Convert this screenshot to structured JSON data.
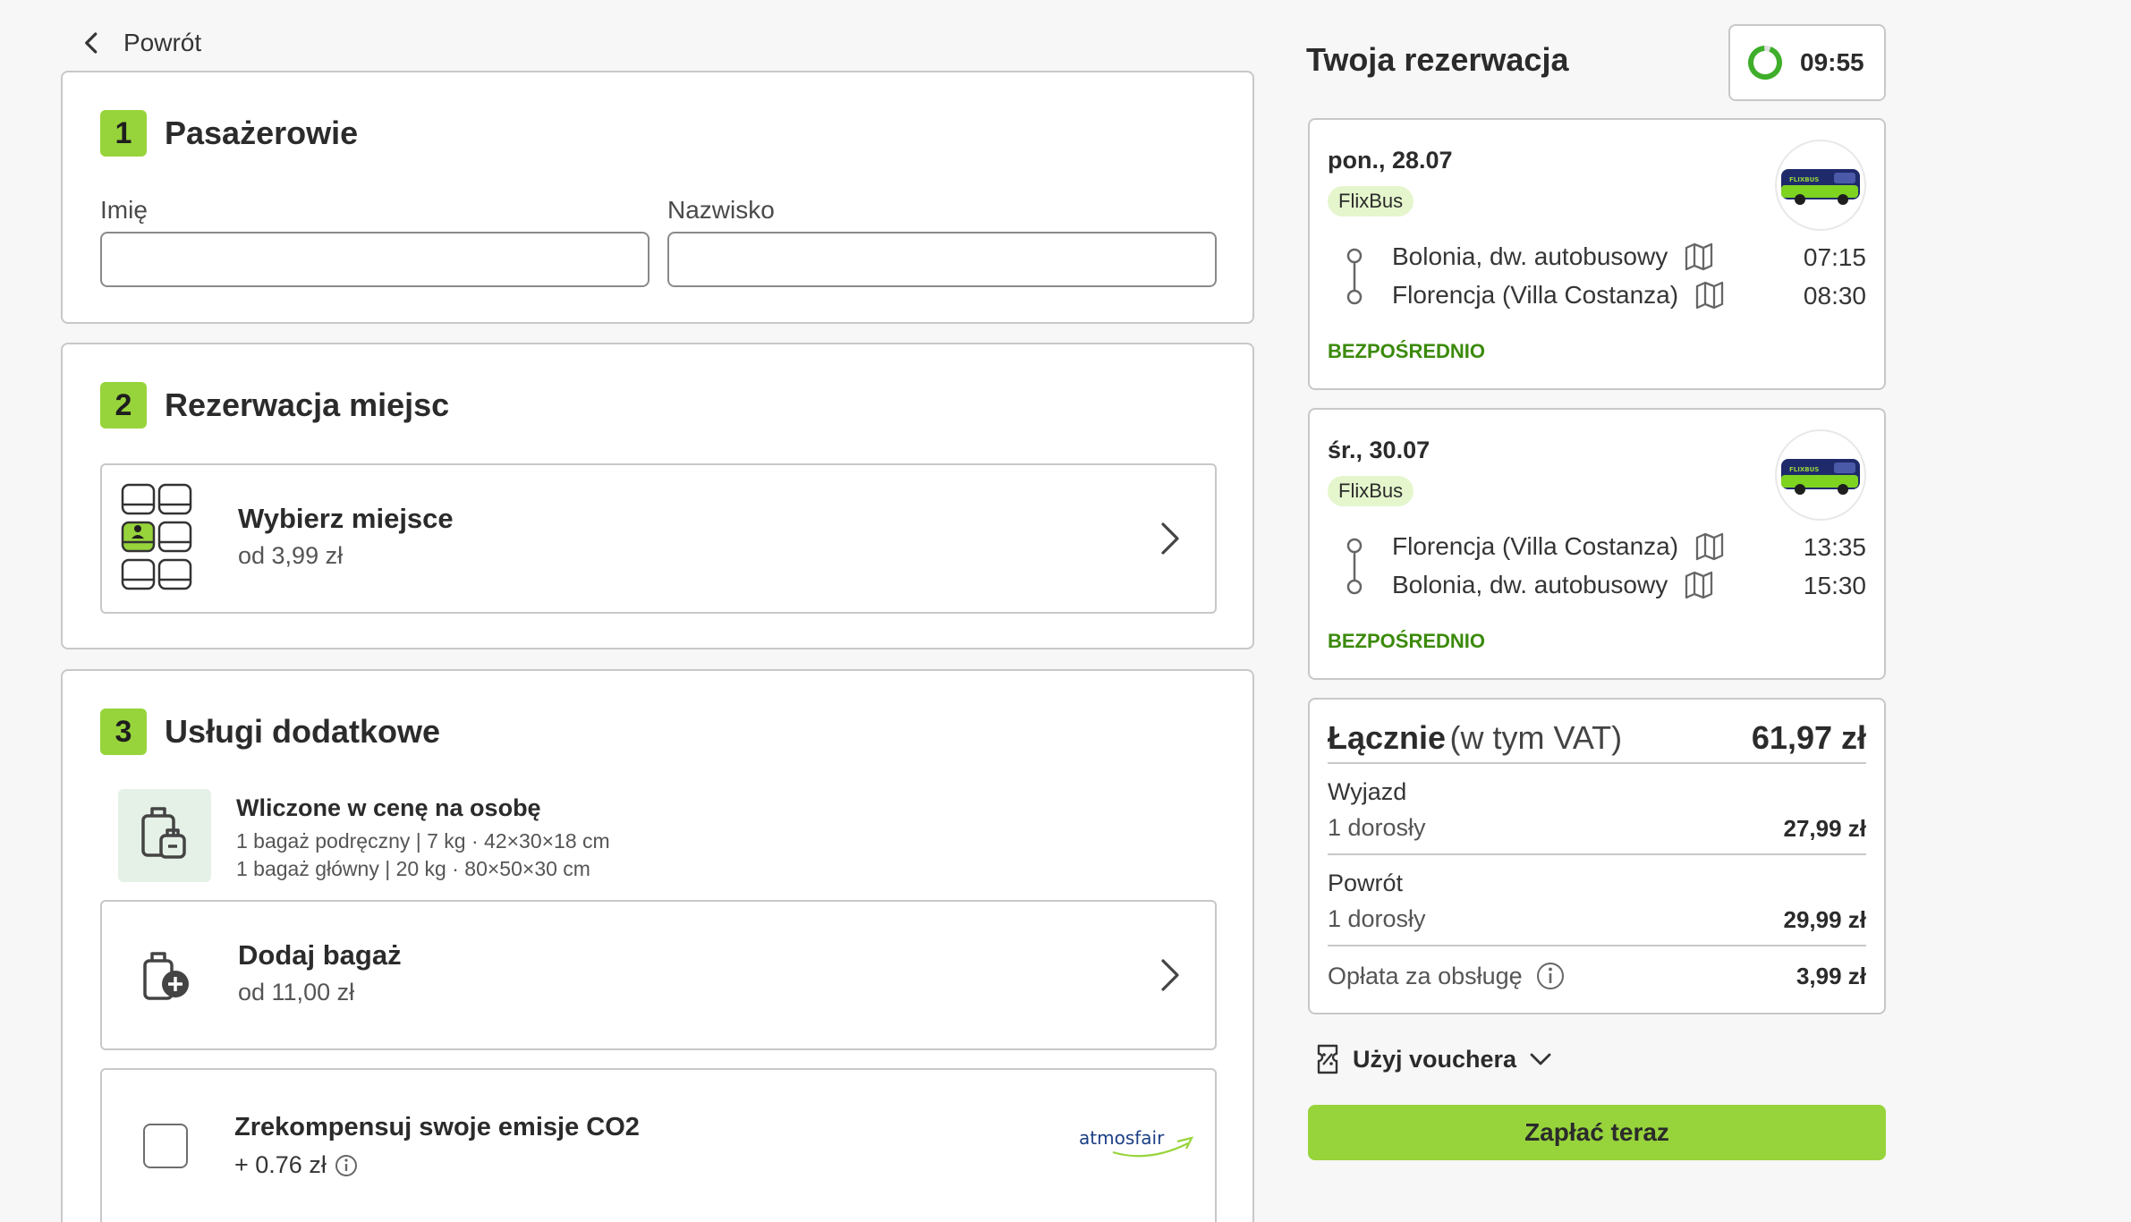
{
  "nav": {
    "back_label": "Powrót"
  },
  "passengers": {
    "step": "1",
    "title": "Pasażerowie",
    "first_name_label": "Imię",
    "first_name_value": "",
    "last_name_label": "Nazwisko",
    "last_name_value": ""
  },
  "seats": {
    "step": "2",
    "title": "Rezerwacja miejsc",
    "option_title": "Wybierz miejsce",
    "option_price": "od 3,99 zł"
  },
  "extras": {
    "step": "3",
    "title": "Usługi dodatkowe",
    "included_title": "Wliczone w cenę na osobę",
    "included_lines": [
      "1 bagaż podręczny | 7 kg · 42×30×18 cm",
      "1 bagaż główny | 20 kg · 80×50×30 cm"
    ],
    "add_bag_title": "Dodaj bagaż",
    "add_bag_price": "od 11,00 zł",
    "co2_title": "Zrekompensuj swoje emisje CO2",
    "co2_price": "+ 0.76 zł",
    "co2_partner": "atmosfair",
    "co2_checked": false
  },
  "reservation": {
    "title": "Twoja rezerwacja",
    "timer": "09:55",
    "trips": [
      {
        "date": "pon., 28.07",
        "brand": "FlixBus",
        "from": "Bolonia, dw. autobusowy",
        "from_time": "07:15",
        "to": "Florencja (Villa Costanza)",
        "to_time": "08:30",
        "type": "BEZPOŚREDNIO"
      },
      {
        "date": "śr., 30.07",
        "brand": "FlixBus",
        "from": "Florencja (Villa Costanza)",
        "from_time": "13:35",
        "to": "Bolonia, dw. autobusowy",
        "to_time": "15:30",
        "type": "BEZPOŚREDNIO"
      }
    ],
    "summary": {
      "total_label": "Łącznie",
      "vat_label": "(w tym VAT)",
      "total": "61,97 zł",
      "outbound_label": "Wyjazd",
      "outbound_pax": "1 dorosły",
      "outbound_price": "27,99 zł",
      "return_label": "Powrót",
      "return_pax": "1 dorosły",
      "return_price": "29,99 zł",
      "fee_label": "Opłata za obsługę",
      "fee_price": "3,99 zł"
    },
    "voucher_label": "Użyj vouchera",
    "pay_label": "Zapłać teraz"
  },
  "colors": {
    "accent": "#97d43b",
    "direct_green": "#3b8a0b",
    "badge_bg": "#e5f6cd",
    "border": "#c8c8c8"
  }
}
